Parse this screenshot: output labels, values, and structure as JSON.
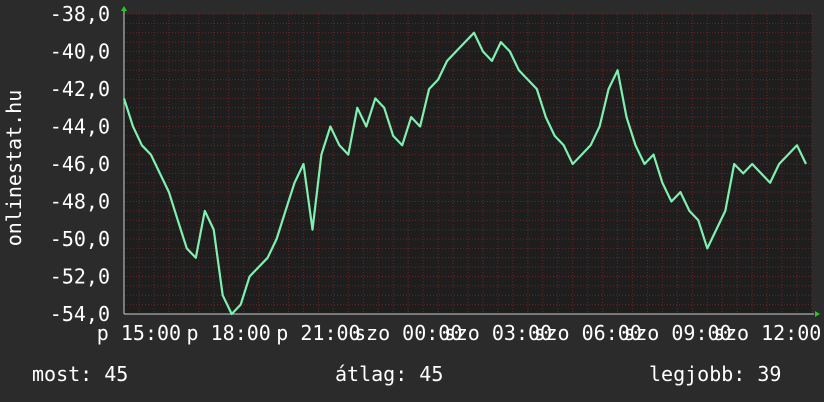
{
  "watermark": "onlinestat.hu",
  "footer": {
    "current": "most: 45",
    "average": "átlag: 45",
    "best": "legjobb: 39"
  },
  "colors": {
    "background": "#2b2b2b",
    "plot_background": "#1e1e1e",
    "grid": "#6a2424",
    "line": "#7ff0b0",
    "axis_arrow": "#22cc22",
    "text": "#ffffff"
  },
  "chart_data": {
    "type": "line",
    "title": "",
    "xlabel": "",
    "ylabel": "",
    "grid": true,
    "ylim": [
      -54,
      -38
    ],
    "xlim": [
      14.5,
      13.5
    ],
    "y_ticks": [
      -38,
      -40,
      -42,
      -44,
      -46,
      -48,
      -50,
      -52,
      -54
    ],
    "y_tick_labels": [
      "-38,0",
      "-40,0",
      "-42,0",
      "-44,0",
      "-46,0",
      "-48,0",
      "-50,0",
      "-52,0",
      "-54,0"
    ],
    "x_ticks": [
      {
        "label": "p 15:00",
        "hours": 15
      },
      {
        "label": "p 18:00",
        "hours": 18
      },
      {
        "label": "p 21:00",
        "hours": 21
      },
      {
        "label": "szo 00:00",
        "hours": 24
      },
      {
        "label": "szo 03:00",
        "hours": 27
      },
      {
        "label": "szo 06:00",
        "hours": 30
      },
      {
        "label": "szo 09:00",
        "hours": 33
      },
      {
        "label": "szo 12:00",
        "hours": 36
      }
    ],
    "series": [
      {
        "name": "",
        "x_hours": [
          14.5,
          14.8,
          15.1,
          15.4,
          15.7,
          16.0,
          16.3,
          16.6,
          16.9,
          17.2,
          17.5,
          17.8,
          18.1,
          18.4,
          18.7,
          19.0,
          19.3,
          19.6,
          19.9,
          20.2,
          20.5,
          20.8,
          21.1,
          21.4,
          21.7,
          22.0,
          22.3,
          22.6,
          22.9,
          23.2,
          23.5,
          23.8,
          24.1,
          24.4,
          24.7,
          25.0,
          25.3,
          25.6,
          25.9,
          26.2,
          26.5,
          26.8,
          27.1,
          27.4,
          27.7,
          28.0,
          28.3,
          28.6,
          28.9,
          29.2,
          29.5,
          29.8,
          30.1,
          30.4,
          30.7,
          31.0,
          31.3,
          31.6,
          31.9,
          32.2,
          32.5,
          32.8,
          33.1,
          33.4,
          33.7,
          34.0,
          34.3,
          34.6,
          34.9,
          35.2,
          35.5,
          35.8,
          36.1,
          36.4,
          36.7,
          37.0,
          37.3
        ],
        "values": [
          -42.5,
          -44,
          -45,
          -45.5,
          -46.5,
          -47.5,
          -49,
          -50.5,
          -51,
          -48.5,
          -49.5,
          -53,
          -54,
          -53.5,
          -52,
          -51.5,
          -51,
          -50,
          -48.5,
          -47,
          -46,
          -49.5,
          -45.5,
          -44,
          -45,
          -45.5,
          -43,
          -44,
          -42.5,
          -43,
          -44.5,
          -45,
          -43.5,
          -44,
          -42,
          -41.5,
          -40.5,
          -40,
          -39.5,
          -39,
          -40,
          -40.5,
          -39.5,
          -40,
          -41,
          -41.5,
          -42,
          -43.5,
          -44.5,
          -45,
          -46,
          -45.5,
          -45,
          -44,
          -42,
          -41,
          -43.5,
          -45,
          -46,
          -45.5,
          -47,
          -48,
          -47.5,
          -48.5,
          -49,
          -50.5,
          -49.5,
          -48.5,
          -46,
          -46.5,
          -46,
          -46.5,
          -47,
          -46,
          -45.5,
          -45,
          -46
        ]
      }
    ]
  }
}
